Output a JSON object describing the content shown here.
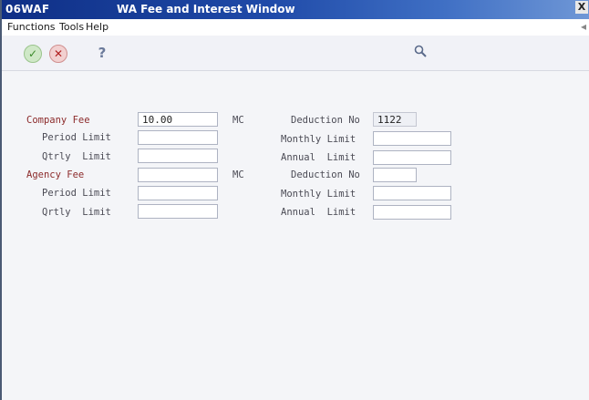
{
  "window": {
    "form_id": "06WAF",
    "title": "WA Fee and Interest Window",
    "close_glyph": "X"
  },
  "menu": {
    "functions": "Functions",
    "tools": "Tools",
    "help": "Help"
  },
  "toolbar": {
    "ok_glyph": "✓",
    "cancel_glyph": "✕",
    "help_glyph": "?",
    "find_glyph": "🔍",
    "icons": [
      "check-icon",
      "cancel-icon",
      "help-icon",
      "search-icon"
    ]
  },
  "form": {
    "company_fee": {
      "label": "Company Fee",
      "value": "10.00",
      "code": "MC"
    },
    "company_deduction": {
      "label": "Deduction No",
      "value": "1122"
    },
    "company_period_limit": {
      "label": "Period Limit",
      "value": ""
    },
    "company_monthly_limit": {
      "label": "Monthly Limit",
      "value": ""
    },
    "company_qtrly_limit": {
      "label": "Qtrly  Limit",
      "value": ""
    },
    "company_annual_limit": {
      "label": "Annual  Limit",
      "value": ""
    },
    "agency_fee": {
      "label": "Agency Fee",
      "value": "",
      "code": "MC"
    },
    "agency_deduction": {
      "label": "Deduction No",
      "value": ""
    },
    "agency_period_limit": {
      "label": "Period Limit",
      "value": ""
    },
    "agency_monthly_limit": {
      "label": "Monthly Limit",
      "value": ""
    },
    "agency_qrtly_limit": {
      "label": "Qrtly  Limit",
      "value": ""
    },
    "agency_annual_limit": {
      "label": "Annual  Limit",
      "value": ""
    }
  },
  "colors": {
    "title_bar": "#1f4aa8",
    "label_accent": "#8c2b2b",
    "background": "#f4f5f8"
  }
}
